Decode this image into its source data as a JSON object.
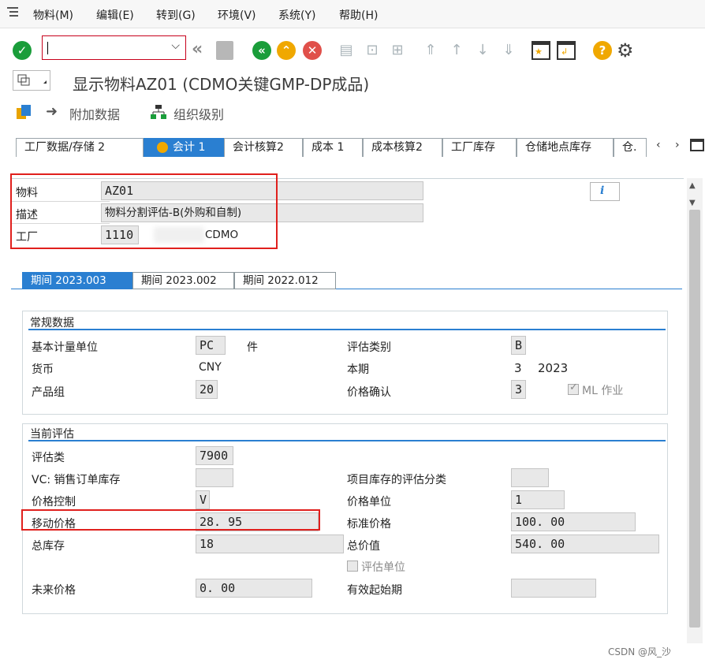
{
  "menu": {
    "items": [
      "物料(M)",
      "编辑(E)",
      "转到(G)",
      "环境(V)",
      "系统(Y)",
      "帮助(H)"
    ]
  },
  "window": {
    "title": "显示物料AZ01 (CDMO关键GMP-DP成品)"
  },
  "app_toolbar": {
    "additional_data": "附加数据",
    "org_levels": "组织级别"
  },
  "tabs": [
    "工厂数据/存储 2",
    "会计 1",
    "会计核算2",
    "成本 1",
    "成本核算2",
    "工厂库存",
    "仓储地点库存",
    "仓."
  ],
  "header": {
    "material_label": "物料",
    "material_value": "AZ01",
    "desc_label": "描述",
    "desc_value": "物料分割评估-B(外购和自制)",
    "plant_label": "工厂",
    "plant_value": "1110",
    "plant_name": "CDMO"
  },
  "period_tabs": [
    "期间 2023.003",
    "期间 2023.002",
    "期间 2022.012"
  ],
  "general": {
    "title": "常规数据",
    "base_uom_label": "基本计量单位",
    "base_uom_value": "PC",
    "base_uom_text": "件",
    "valuation_cat_label": "评估类别",
    "valuation_cat_value": "B",
    "currency_label": "货币",
    "currency_value": "CNY",
    "current_period_label": "本期",
    "current_period_value": "3",
    "current_year": "2023",
    "division_label": "产品组",
    "division_value": "20",
    "price_determination_label": "价格确认",
    "price_determination_value": "3",
    "ml_act_label": "ML 作业"
  },
  "valuation": {
    "title": "当前评估",
    "valuation_class_label": "评估类",
    "valuation_class_value": "7900",
    "vc_label": "VC: 销售订单库存",
    "vc_value": "",
    "proj_stock_label": "项目库存的评估分类",
    "proj_stock_value": "",
    "price_control_label": "价格控制",
    "price_control_value": "V",
    "price_unit_label": "价格单位",
    "price_unit_value": "1",
    "moving_price_label": "移动价格",
    "moving_price_value": "28. 95",
    "standard_price_label": "标准价格",
    "standard_price_value": "100. 00",
    "total_stock_label": "总库存",
    "total_stock_value": "18",
    "total_value_label": "总价值",
    "total_value_value": "540. 00",
    "valuated_unit_label": "评估单位",
    "future_price_label": "未来价格",
    "future_price_value": "0. 00",
    "valid_from_label": "有效起始期",
    "valid_from_value": ""
  },
  "watermark": "CSDN @风_沙",
  "colors": {
    "accent": "#2a7fd1",
    "highlight_border": "#e0201d",
    "field_bg": "#e8e8e8"
  }
}
